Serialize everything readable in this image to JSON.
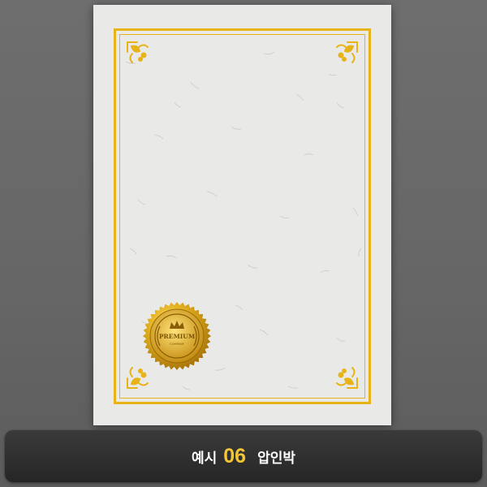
{
  "colors": {
    "background": "#6a6a6a",
    "paper": "#e9eae7",
    "gold": "#e8b318",
    "caption_bar": "#2e2e2e",
    "caption_number": "#f4c633"
  },
  "seal": {
    "icon": "crown-icon",
    "text_main": "PREMIUM",
    "text_sub": "COMPANY"
  },
  "caption": {
    "prefix": "예시",
    "number": "06",
    "label": "압인박"
  }
}
